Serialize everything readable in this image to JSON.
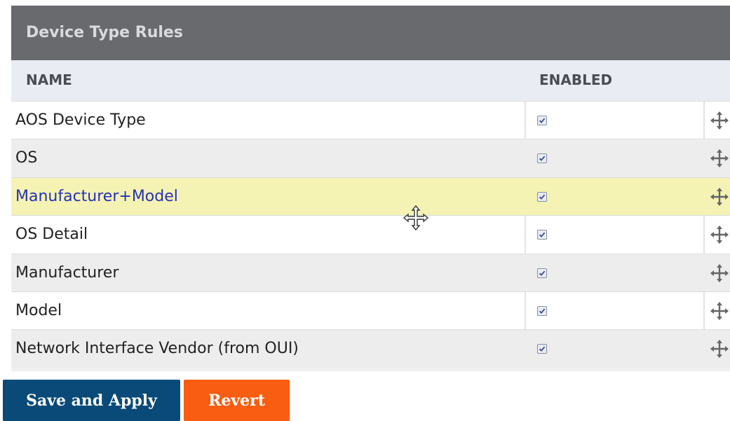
{
  "panel": {
    "title": "Device Type Rules",
    "columns": {
      "name": "NAME",
      "enabled": "ENABLED"
    }
  },
  "rules": [
    {
      "name": "AOS Device Type",
      "enabled": true
    },
    {
      "name": "OS",
      "enabled": true
    },
    {
      "name": "Manufacturer+Model",
      "enabled": true
    },
    {
      "name": "OS Detail",
      "enabled": true
    },
    {
      "name": "Manufacturer",
      "enabled": true
    },
    {
      "name": "Model",
      "enabled": true
    },
    {
      "name": "Network Interface Vendor (from OUI)",
      "enabled": true
    }
  ],
  "highlighted_row": "Manufacturer+Model",
  "buttons": {
    "save_label": "Save and Apply",
    "revert_label": "Revert"
  },
  "colors": {
    "header_bg": "#696a6d",
    "highlight_bg": "#f4f3b3",
    "save_button": "#0a4a78",
    "revert_button": "#f95d12",
    "highlight_text": "#2432b8"
  }
}
